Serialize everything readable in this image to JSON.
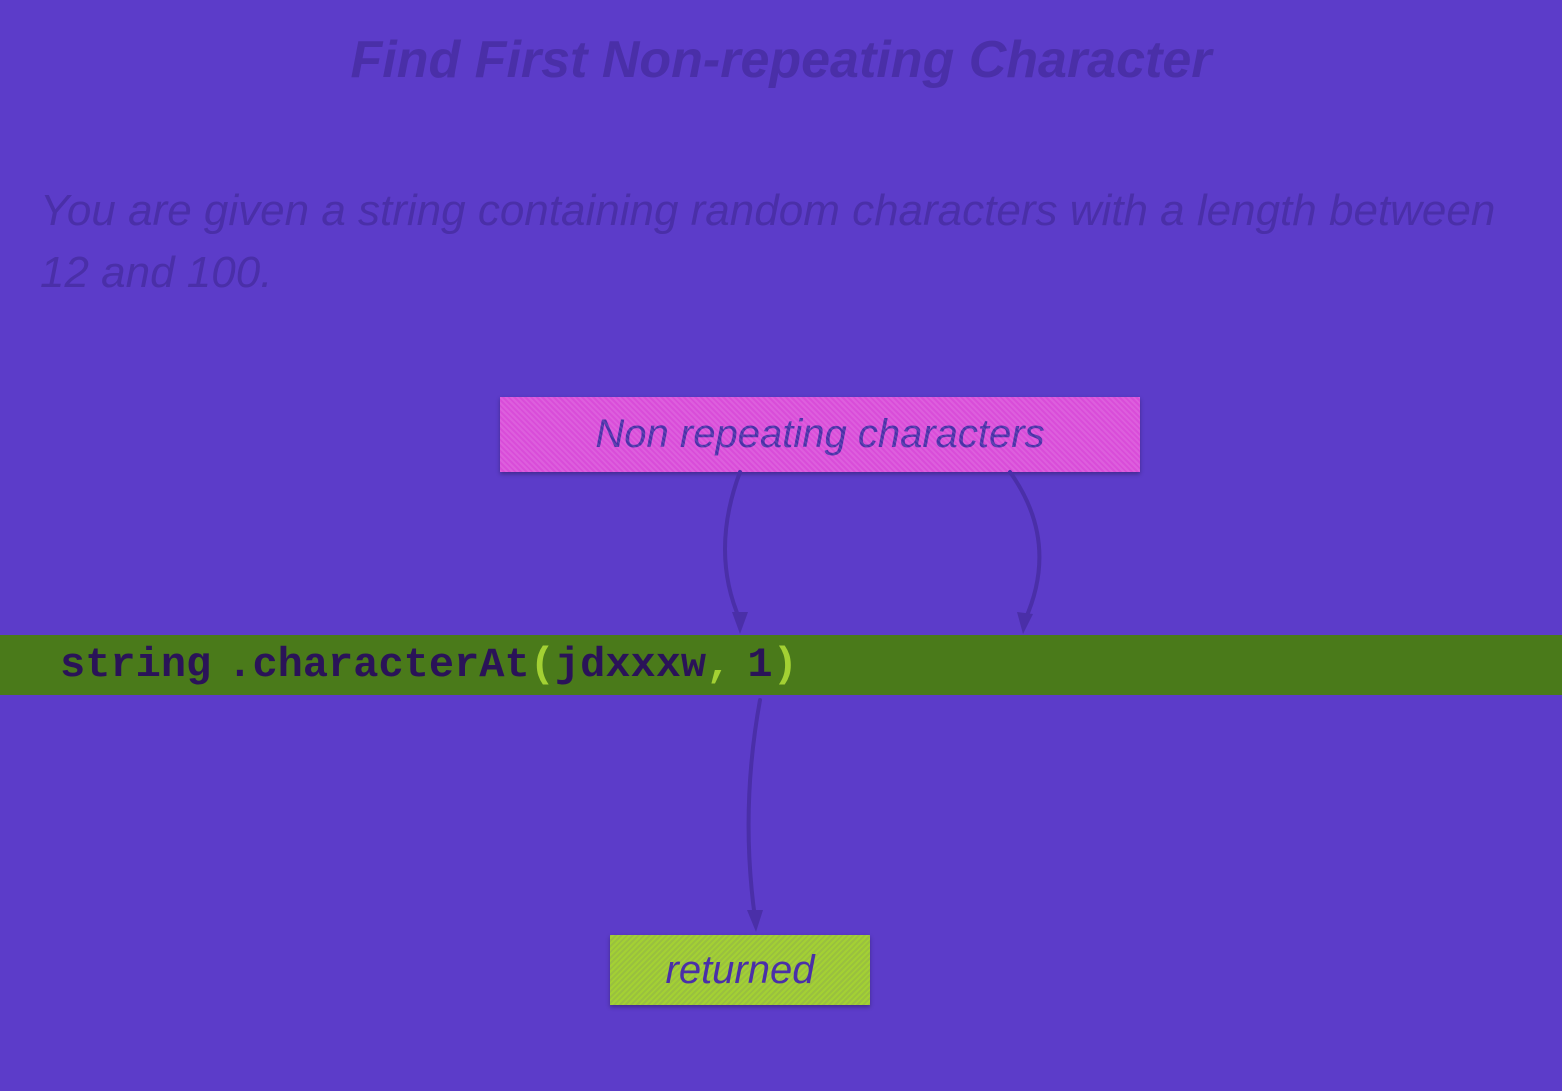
{
  "title": "Find First Non-repeating Character",
  "description": "You are given a string containing random characters with a length between 12 and 100.",
  "top_label": "Non repeating characters",
  "code": {
    "token1": "string",
    "token2": ".characterAt",
    "token3": "(",
    "token4": "jdxxxw",
    "token5": ",",
    "token6": "1",
    "token7": ")"
  },
  "bottom_label": "returned"
}
